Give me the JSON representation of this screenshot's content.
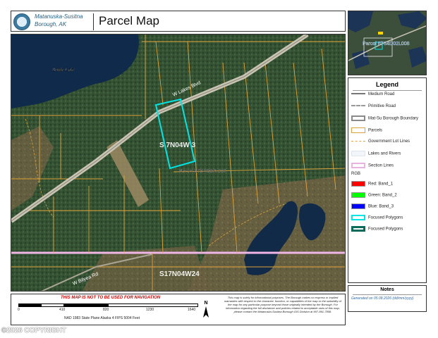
{
  "header": {
    "org_line1": "Matanuska-Susitna",
    "org_line2": "Borough, AK",
    "title": "Parcel Map"
  },
  "map": {
    "lake_label": "Bottle Lake",
    "road_label": "W Lakes Blvd",
    "road_label_2": "W Bilyea Rd",
    "section_label_1": "S 7N04W 3",
    "section_label_2": "S17N04W24",
    "parcel_label": "Parcel 87S4D02L008"
  },
  "inset": {
    "parcel_label": "Parcel 87S4D02L008"
  },
  "legend": {
    "title": "Legend",
    "items": [
      {
        "label": "Medium Road",
        "symbol": "medium-road"
      },
      {
        "label": "Primitive Road",
        "symbol": "primitive-road"
      },
      {
        "label": "Mat-Su Borough Boundary",
        "symbol": "borough-boundary"
      },
      {
        "label": "Parcels",
        "symbol": "parcels"
      },
      {
        "label": "Government Lot Lines",
        "symbol": "gov-lot-lines"
      },
      {
        "label": "Lakes and Rivers",
        "symbol": "lakes-rivers"
      },
      {
        "label": "Section Lines",
        "symbol": "section-lines"
      }
    ],
    "rgb_heading": "RGB",
    "bands": [
      {
        "label": "Red:  Band_1",
        "color": "#ff0000"
      },
      {
        "label": "Green:  Band_2",
        "color": "#00ff00"
      },
      {
        "label": "Blue:  Band_3",
        "color": "#0000ff"
      }
    ],
    "focused": [
      {
        "label": "Focused Polygons",
        "color": "#00e5e5"
      },
      {
        "label": "Focused Polygons",
        "color": "#0b6b5b"
      }
    ]
  },
  "notes": {
    "title": "Notes",
    "text": "Generated on 05.08.2026 (dd/mm/yyyy)"
  },
  "footer": {
    "nav_warning": "THIS MAP IS NOT TO BE USED FOR NAVIGATION",
    "scale_ticks": [
      "0",
      "410",
      "820",
      "1230",
      "1640"
    ],
    "projection": "NAD 1983 State Plane Alaska 4 FIPS 5004 Feet",
    "north": "N",
    "disclaimer": "This map is solely for informational purposes. The Borough makes no express or implied warranties with respect to the character, function, or capabilities of the map or the suitability of the map for any particular purpose beyond those originally intended by the Borough. For information regarding the full disclaimer and policies related to acceptable uses of this map, please contact the Matanuska-Susitna Borough GIS Division at 907-861-7858."
  },
  "copyright": "©2026 COPYRIGHT"
}
